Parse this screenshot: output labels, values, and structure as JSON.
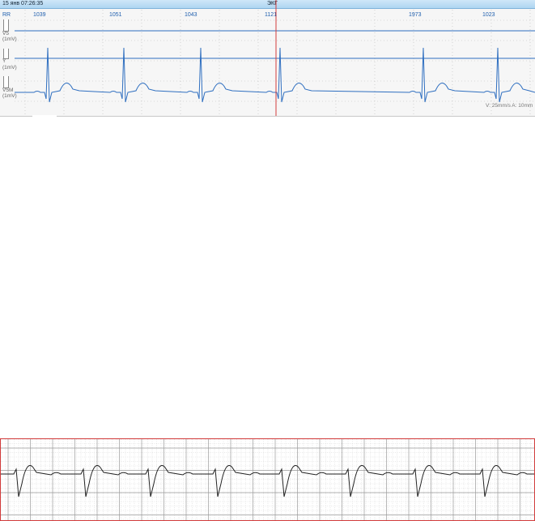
{
  "viewer": {
    "timestamp": "15 янв 07:26:35",
    "mode_label": "ЭКГ",
    "rr_header": "RR",
    "rr_intervals": [
      "1039",
      "1051",
      "1043",
      "1121",
      "1973",
      "1023"
    ],
    "leads": [
      {
        "name": "V5",
        "gain": "(1mV)"
      },
      {
        "name": "Y",
        "gain": "(1mV)"
      },
      {
        "name": "V5M",
        "gain": "(1mV)"
      }
    ],
    "scale_note": "V: 25mm/s  A: 10mm",
    "colors": {
      "trace": "#2f6fc0",
      "cursor": "#d23c3c",
      "titlebar": "#aed5f1"
    }
  },
  "strip": {
    "colors": {
      "border": "#d23c3c",
      "grid": "#bdbdbd",
      "trace": "#222222"
    }
  }
}
